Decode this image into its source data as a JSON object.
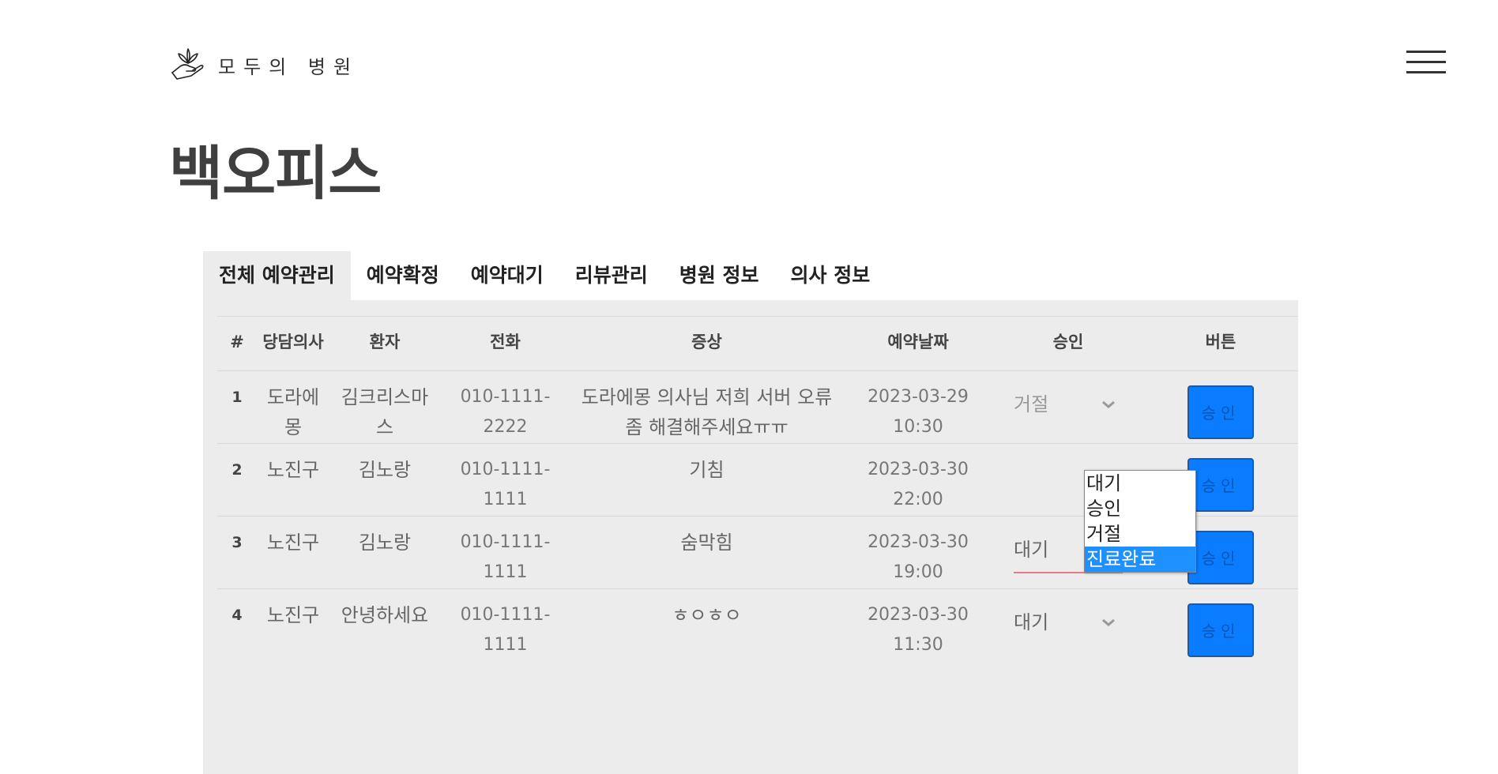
{
  "brand": {
    "name": "모두의 병원"
  },
  "page": {
    "title": "백오피스"
  },
  "tabs": [
    "전체 예약관리",
    "예약확정",
    "예약대기",
    "리뷰관리",
    "병원 정보",
    "의사 정보"
  ],
  "table": {
    "headers": [
      "#",
      "당담의사",
      "환자",
      "전화",
      "증상",
      "예약날짜",
      "승인",
      "버튼"
    ],
    "rows": [
      {
        "num": "1",
        "doctor": "도라에몽",
        "patient": "김크리스마스",
        "phone": "010-1111-2222",
        "symptom": "도라에몽 의사님 저희 서버 오류좀 해결해주세요ㅠㅠ",
        "date": "2023-03-29",
        "time": "10:30",
        "status": "거절",
        "button": "승인"
      },
      {
        "num": "2",
        "doctor": "노진구",
        "patient": "김노랑",
        "phone": "010-1111-1111",
        "symptom": "기침",
        "date": "2023-03-30",
        "time": "22:00",
        "status": "",
        "button": "승인"
      },
      {
        "num": "3",
        "doctor": "노진구",
        "patient": "김노랑",
        "phone": "010-1111-1111",
        "symptom": "숨막힘",
        "date": "2023-03-30",
        "time": "19:00",
        "status": "대기",
        "button": "승인"
      },
      {
        "num": "4",
        "doctor": "노진구",
        "patient": "안녕하세요",
        "phone": "010-1111-1111",
        "symptom": "ㅎㅇㅎㅇ",
        "date": "2023-03-30",
        "time": "11:30",
        "status": "대기",
        "button": "승인"
      }
    ]
  },
  "dropdown": {
    "options": [
      "대기",
      "승인",
      "거절",
      "진료완료"
    ],
    "selected": "진료완료"
  },
  "colors": {
    "accent": "#0a7cff",
    "selected_option": "#1e90ff",
    "panel_bg": "#ececec",
    "focus_underline": "#e77b8d"
  },
  "icons": {
    "logo": "hand-leaf-icon",
    "menu": "hamburger-icon",
    "chevron": "chevron-down-icon"
  }
}
